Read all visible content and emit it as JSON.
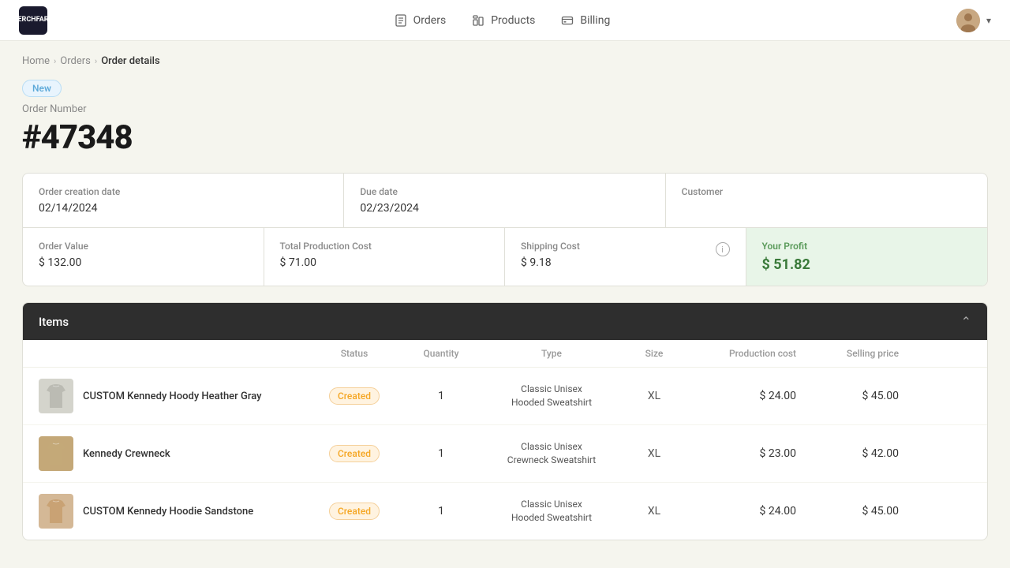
{
  "header": {
    "logo_line1": "MERCH",
    "logo_line2": "FARM",
    "nav": [
      {
        "id": "orders",
        "label": "Orders",
        "icon": "orders-icon"
      },
      {
        "id": "products",
        "label": "Products",
        "icon": "products-icon"
      },
      {
        "id": "billing",
        "label": "Billing",
        "icon": "billing-icon"
      }
    ]
  },
  "breadcrumb": {
    "items": [
      {
        "label": "Home",
        "link": true
      },
      {
        "label": "Orders",
        "link": true
      },
      {
        "label": "Order details",
        "link": false
      }
    ]
  },
  "order": {
    "status": "New",
    "number_label": "Order Number",
    "number": "#47348",
    "creation_date_label": "Order creation date",
    "creation_date": "02/14/2024",
    "due_date_label": "Due date",
    "due_date": "02/23/2024",
    "customer_label": "Customer",
    "customer_value": "",
    "order_value_label": "Order Value",
    "order_value": "$ 132.00",
    "production_cost_label": "Total Production Cost",
    "production_cost": "$ 71.00",
    "shipping_cost_label": "Shipping Cost",
    "shipping_cost": "$ 9.18",
    "profit_label": "Your Profit",
    "profit_value": "$ 51.82"
  },
  "items_section": {
    "title": "Items",
    "toggle_icon": "chevron-up-icon",
    "table_headers": {
      "product": "",
      "status": "Status",
      "quantity": "Quantity",
      "type": "Type",
      "size": "Size",
      "production_cost": "Production cost",
      "selling_price": "Selling price"
    },
    "rows": [
      {
        "id": 1,
        "name": "CUSTOM Kennedy Hoody Heather Gray",
        "status": "Created",
        "quantity": "1",
        "type_line1": "Classic Unisex",
        "type_line2": "Hooded Sweatshirt",
        "size": "XL",
        "production_cost": "$ 24.00",
        "selling_price": "$ 45.00",
        "thumb_style": "gray"
      },
      {
        "id": 2,
        "name": "Kennedy Crewneck",
        "status": "Created",
        "quantity": "1",
        "type_line1": "Classic Unisex",
        "type_line2": "Crewneck Sweatshirt",
        "size": "XL",
        "production_cost": "$ 23.00",
        "selling_price": "$ 42.00",
        "thumb_style": "crewneck"
      },
      {
        "id": 3,
        "name": "CUSTOM Kennedy Hoodie Sandstone",
        "status": "Created",
        "quantity": "1",
        "type_line1": "Classic Unisex",
        "type_line2": "Hooded Sweatshirt",
        "size": "XL",
        "production_cost": "$ 24.00",
        "selling_price": "$ 45.00",
        "thumb_style": "sand"
      }
    ]
  }
}
